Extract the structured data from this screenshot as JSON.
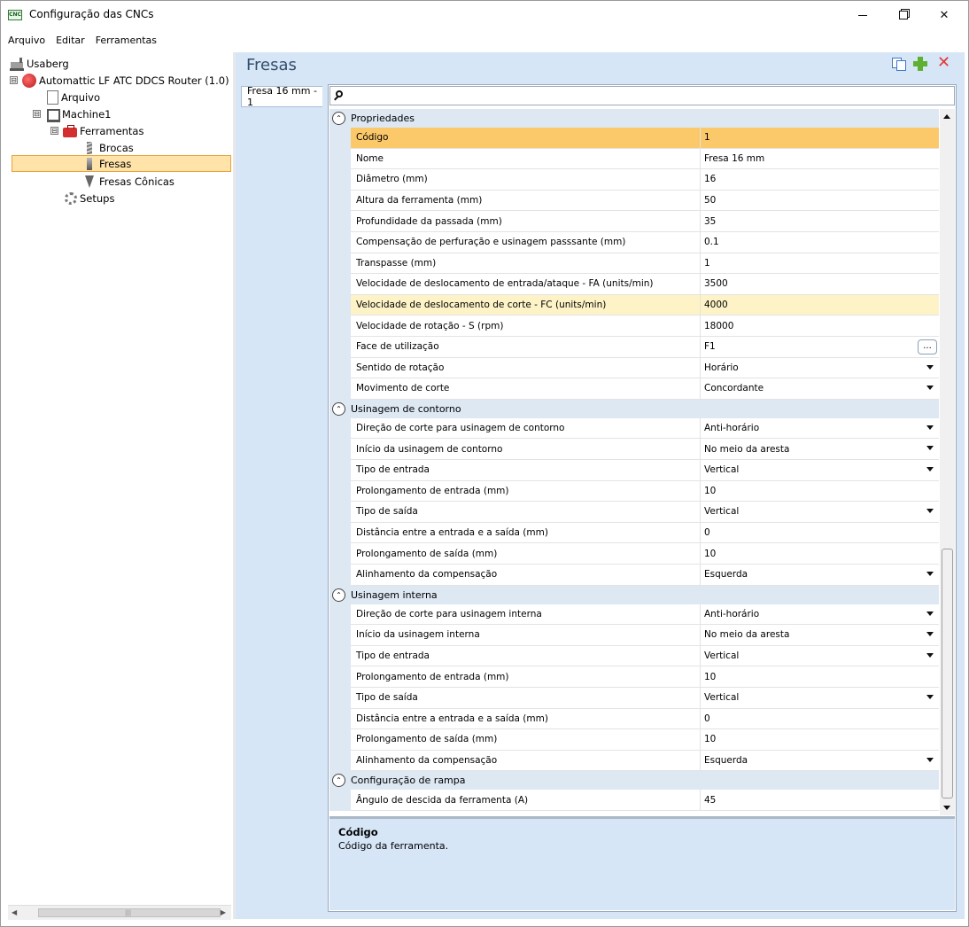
{
  "window": {
    "title": "Configuração das CNCs",
    "app_icon_text": "CNC"
  },
  "menu": [
    "Arquivo",
    "Editar",
    "Ferramentas"
  ],
  "tree": {
    "root": "Usaberg",
    "router": "Automattic LF ATC DDCS Router (1.0)",
    "arquivo": "Arquivo",
    "machine": "Machine1",
    "ferramentas": "Ferramentas",
    "brocas": "Brocas",
    "fresas": "Fresas",
    "fresas_conicas": "Fresas Cônicas",
    "setups": "Setups",
    "toggle_minus": "⊟"
  },
  "panel": {
    "title": "Fresas",
    "tab_label": "Fresa 16 mm - 1",
    "ellipsis": "..."
  },
  "categories": {
    "propriedades": "Propriedades",
    "contorno": "Usinagem de contorno",
    "interna": "Usinagem interna",
    "rampa": "Configuração de rampa"
  },
  "properties": [
    {
      "name": "Código",
      "value": "1"
    },
    {
      "name": "Nome",
      "value": "Fresa 16 mm"
    },
    {
      "name": "Diâmetro (mm)",
      "value": "16"
    },
    {
      "name": "Altura da ferramenta (mm)",
      "value": "50"
    },
    {
      "name": "Profundidade da passada (mm)",
      "value": "35"
    },
    {
      "name": "Compensação de perfuração e usinagem passsante (mm)",
      "value": "0.1"
    },
    {
      "name": "Transpasse (mm)",
      "value": "1"
    },
    {
      "name": "Velocidade de deslocamento de entrada/ataque - FA (units/min)",
      "value": "3500"
    },
    {
      "name": "Velocidade de deslocamento de corte - FC (units/min)",
      "value": "4000"
    },
    {
      "name": "Velocidade de rotação - S (rpm)",
      "value": "18000"
    },
    {
      "name": "Face de utilização",
      "value": "F1"
    },
    {
      "name": "Sentido de rotação",
      "value": "Horário"
    },
    {
      "name": "Movimento de corte",
      "value": "Concordante"
    }
  ],
  "contorno": [
    {
      "name": "Direção de corte para usinagem de contorno",
      "value": "Anti-horário"
    },
    {
      "name": "Início da usinagem de contorno",
      "value": "No meio da aresta"
    },
    {
      "name": "Tipo de entrada",
      "value": "Vertical"
    },
    {
      "name": "Prolongamento de entrada (mm)",
      "value": "10"
    },
    {
      "name": "Tipo de saída",
      "value": "Vertical"
    },
    {
      "name": "Distância entre a entrada e a saída (mm)",
      "value": "0"
    },
    {
      "name": "Prolongamento de saída (mm)",
      "value": "10"
    },
    {
      "name": "Alinhamento da compensação",
      "value": "Esquerda"
    }
  ],
  "interna": [
    {
      "name": "Direção de corte para usinagem interna",
      "value": "Anti-horário"
    },
    {
      "name": "Início da usinagem interna",
      "value": "No meio da aresta"
    },
    {
      "name": "Tipo de entrada",
      "value": "Vertical"
    },
    {
      "name": "Prolongamento de entrada (mm)",
      "value": "10"
    },
    {
      "name": "Tipo de saída",
      "value": "Vertical"
    },
    {
      "name": "Distância entre a entrada e a saída (mm)",
      "value": "0"
    },
    {
      "name": "Prolongamento de saída (mm)",
      "value": "10"
    },
    {
      "name": "Alinhamento da compensação",
      "value": "Esquerda"
    }
  ],
  "rampa": [
    {
      "name": "Ângulo de descida da ferramenta (A)",
      "value": "45"
    }
  ],
  "description": {
    "title": "Código",
    "body": "Código da ferramenta."
  }
}
